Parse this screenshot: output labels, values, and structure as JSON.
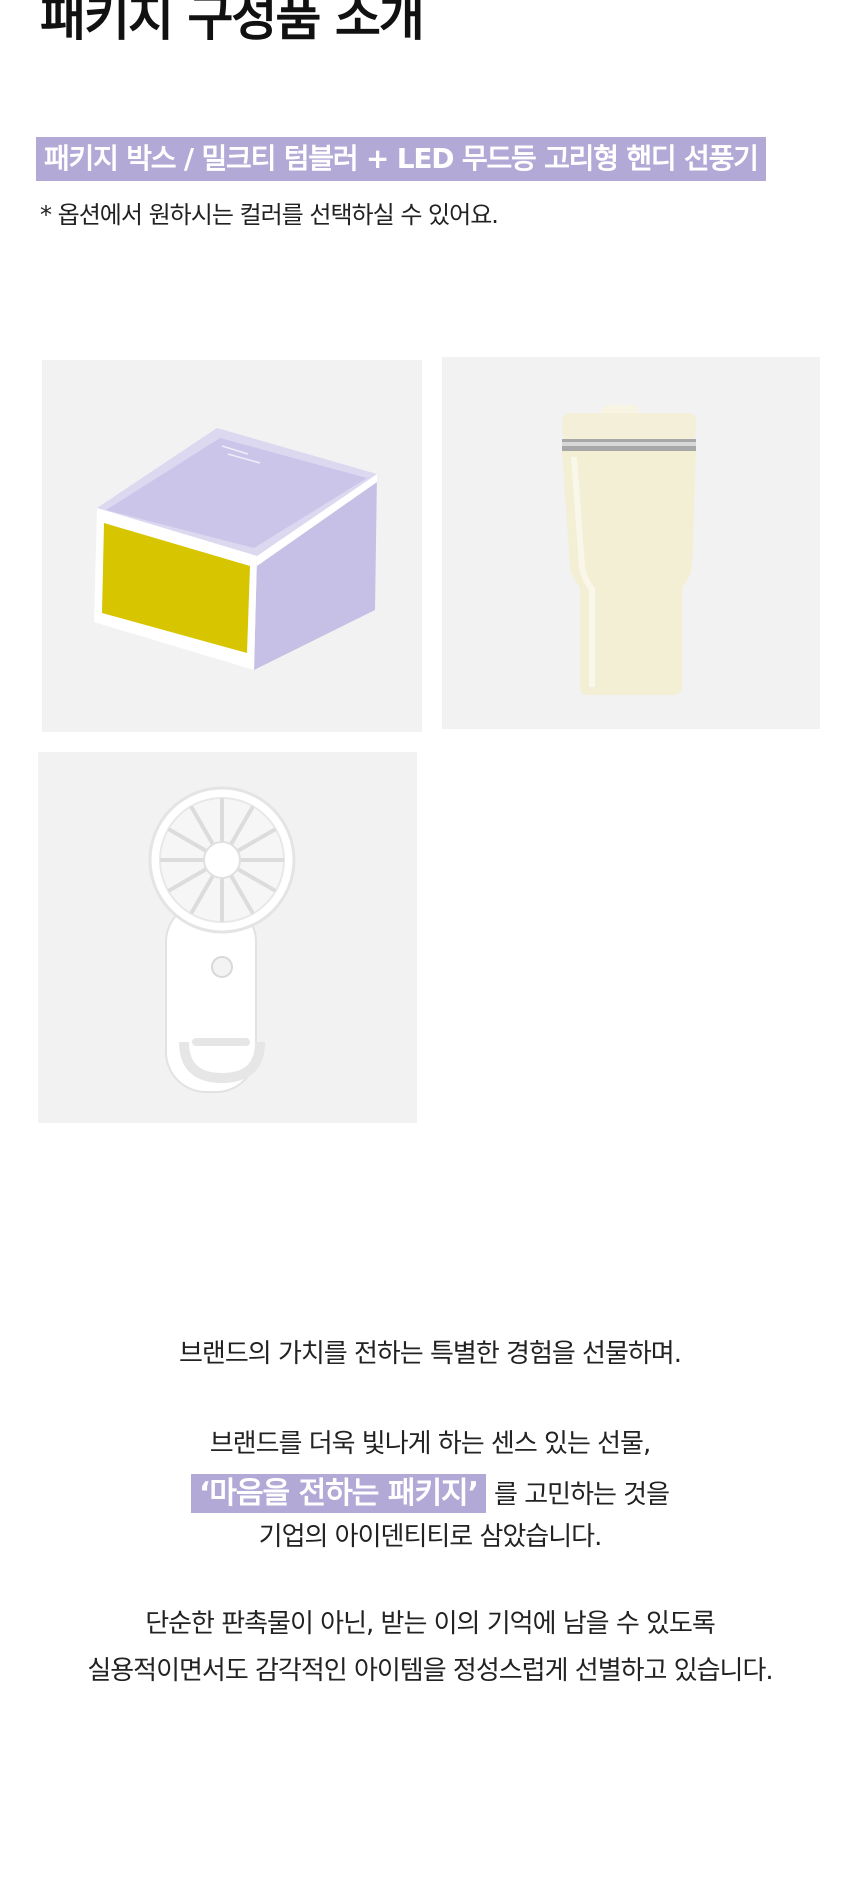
{
  "header": {
    "title": "패키지 구성품 소개"
  },
  "package": {
    "highlight": "패키지 박스 / 밀크티 텀블러 + LED 무드등 고리형 핸디 선풍기",
    "note": "* 옵션에서 원하시는 컬러를 선택하실 수 있어요."
  },
  "images": {
    "box": "package-box-image",
    "tumbler": "milk-tea-tumbler-image",
    "fan": "handy-fan-image"
  },
  "colors": {
    "accent": "#b2a9d6",
    "tile_bg": "#f2f2f2",
    "box_purple": "#c6c0e6",
    "box_yellow": "#d7c500",
    "tumbler_cream": "#f3efd4"
  },
  "copy": {
    "line1": "브랜드의 가치를 전하는  특별한 경험을 선물하며.",
    "line2": "브랜드를 더욱 빛나게 하는 센스 있는 선물,",
    "line3_highlight": "‘마음을 전하는 패키지’",
    "line3_rest": "를 고민하는 것을",
    "line4": "기업의 아이덴티티로 삼았습니다.",
    "line5": "단순한 판촉물이 아닌, 받는 이의 기억에 남을 수 있도록",
    "line6": "실용적이면서도 감각적인 아이템을 정성스럽게 선별하고 있습니다."
  }
}
